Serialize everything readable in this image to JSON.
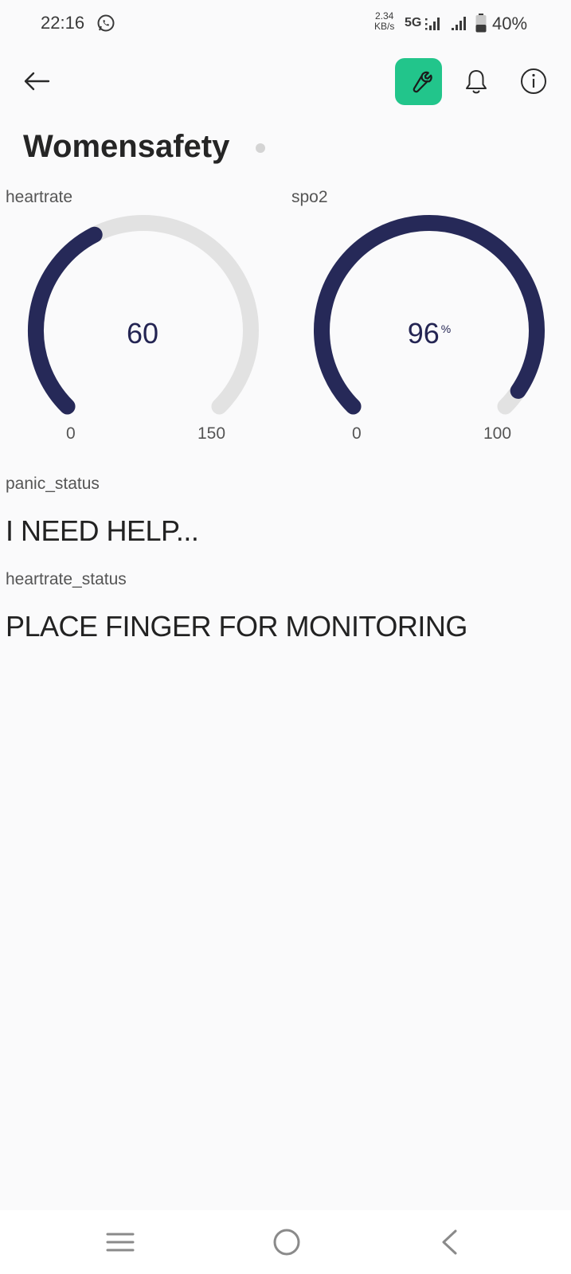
{
  "status_bar": {
    "time": "22:16",
    "net_speed_value": "2.34",
    "net_speed_unit": "KB/s",
    "network": "5G",
    "battery_percent": "40%",
    "battery_level": 0.4
  },
  "header": {
    "title": "Womensafety",
    "online_status_color": "#d4d4d4",
    "accent_color": "#22c58b"
  },
  "widgets": {
    "heartrate": {
      "label": "heartrate",
      "value": "60",
      "value_num": 60,
      "unit": "",
      "min": "0",
      "max": "150",
      "min_num": 0,
      "max_num": 150,
      "color": "#262958"
    },
    "spo2": {
      "label": "spo2",
      "value": "96",
      "value_num": 96,
      "unit": "%",
      "min": "0",
      "max": "100",
      "min_num": 0,
      "max_num": 100,
      "color": "#262958"
    },
    "panic_status": {
      "label": "panic_status",
      "value": "I NEED HELP..."
    },
    "heartrate_status": {
      "label": "heartrate_status",
      "value": "PLACE FINGER FOR MONITORING"
    }
  },
  "icons": {
    "back": "arrow-left-icon",
    "wrench": "wrench-icon",
    "bell": "bell-icon",
    "info": "info-icon",
    "nav_menu": "menu-icon",
    "nav_home": "home-circle-icon",
    "nav_back": "chevron-left-icon"
  }
}
